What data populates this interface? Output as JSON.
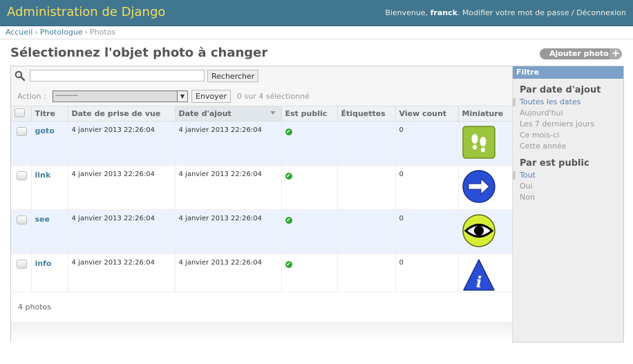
{
  "header": {
    "site_name": "Administration de Django",
    "welcome": "Bienvenue,",
    "user": "franck",
    "change_password": "Modifier votre mot de passe",
    "separator": "/",
    "logout": "Déconnexion"
  },
  "breadcrumbs": {
    "home": "Accueil",
    "app": "Photologue",
    "current": "Photos",
    "sep": "›"
  },
  "page": {
    "title": "Sélectionnez l'objet photo à changer",
    "add_label": "Ajouter photo",
    "add_icon": "+"
  },
  "search": {
    "value": "",
    "button": "Rechercher",
    "icon": "search-icon"
  },
  "actions": {
    "label": "Action :",
    "selected": "---------",
    "go": "Envoyer",
    "counter": "0 sur 4 sélectionné"
  },
  "table": {
    "columns": [
      "Titre",
      "Date de prise de vue",
      "Date d'ajout",
      "Est public",
      "Étiquettes",
      "View count",
      "Miniature"
    ],
    "sorted_column": "Date d'ajout",
    "rows": [
      {
        "title": "goto",
        "date_taken": "4 janvier 2013 22:26:04",
        "date_added": "4 janvier 2013 22:26:04",
        "is_public": true,
        "tags": "",
        "view_count": "0",
        "thumbnail": "footprints-icon"
      },
      {
        "title": "link",
        "date_taken": "4 janvier 2013 22:26:04",
        "date_added": "4 janvier 2013 22:26:04",
        "is_public": true,
        "tags": "",
        "view_count": "0",
        "thumbnail": "arrow-right-icon"
      },
      {
        "title": "see",
        "date_taken": "4 janvier 2013 22:26:04",
        "date_added": "4 janvier 2013 22:26:04",
        "is_public": true,
        "tags": "",
        "view_count": "0",
        "thumbnail": "eye-icon"
      },
      {
        "title": "info",
        "date_taken": "4 janvier 2013 22:26:04",
        "date_added": "4 janvier 2013 22:26:04",
        "is_public": true,
        "tags": "",
        "view_count": "0",
        "thumbnail": "info-icon"
      }
    ]
  },
  "paginator": "4 photos",
  "filter": {
    "title": "Filtre",
    "groups": [
      {
        "heading": "Par date d'ajout",
        "options": [
          "Toutes les dates",
          "Aujourd'hui",
          "Les 7 derniers jours",
          "Ce mois-ci",
          "Cette année"
        ],
        "selected": 0
      },
      {
        "heading": "Par est public",
        "options": [
          "Tout",
          "Oui",
          "Non"
        ],
        "selected": 0
      }
    ]
  },
  "colors": {
    "header_bg": "#417690",
    "brand_text": "#f5dd5d",
    "filter_title_bg": "#7ca0c7",
    "row_alt": "#edf3fe",
    "public_check": "#2fa52f"
  }
}
